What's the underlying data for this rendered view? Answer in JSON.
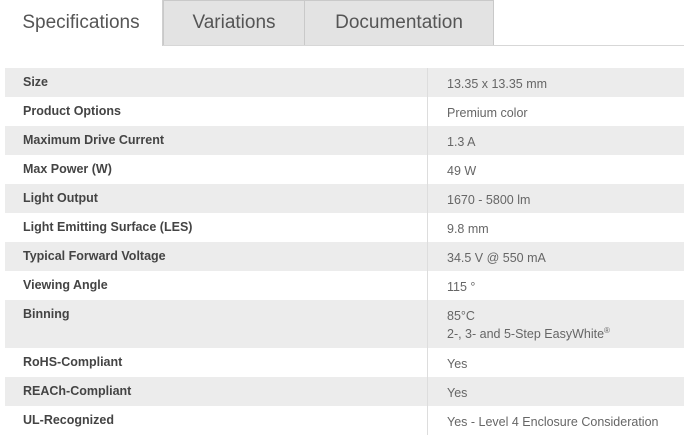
{
  "tabs": [
    {
      "label": "Specifications",
      "active": true
    },
    {
      "label": "Variations",
      "active": false
    },
    {
      "label": "Documentation",
      "active": false
    }
  ],
  "specs": [
    {
      "label": "Size",
      "value": "13.35 x 13.35 mm"
    },
    {
      "label": "Product Options",
      "value": "Premium color"
    },
    {
      "label": "Maximum Drive Current",
      "value": "1.3 A"
    },
    {
      "label": "Max Power (W)",
      "value": "49 W"
    },
    {
      "label": "Light Output",
      "value": "1670 - 5800 lm"
    },
    {
      "label": "Light Emitting Surface (LES)",
      "value": "9.8 mm"
    },
    {
      "label": "Typical Forward Voltage",
      "value": "34.5 V @ 550 mA"
    },
    {
      "label": "Viewing Angle",
      "value": "115 °"
    },
    {
      "label": "Binning",
      "value_line1": "85°C",
      "value_line2": "2-, 3- and 5-Step EasyWhite",
      "value_line2_sup": "®"
    },
    {
      "label": "RoHS-Compliant",
      "value": "Yes"
    },
    {
      "label": "REACh-Compliant",
      "value": "Yes"
    },
    {
      "label": "UL-Recognized",
      "value": "Yes - Level 4 Enclosure Consideration"
    }
  ],
  "colors": {
    "active_tab_bg": "#ffffff",
    "inactive_tab_bg": "#e3e3e3",
    "shaded_row_bg": "#ececec",
    "label_text": "#444444",
    "value_text": "#666666"
  }
}
